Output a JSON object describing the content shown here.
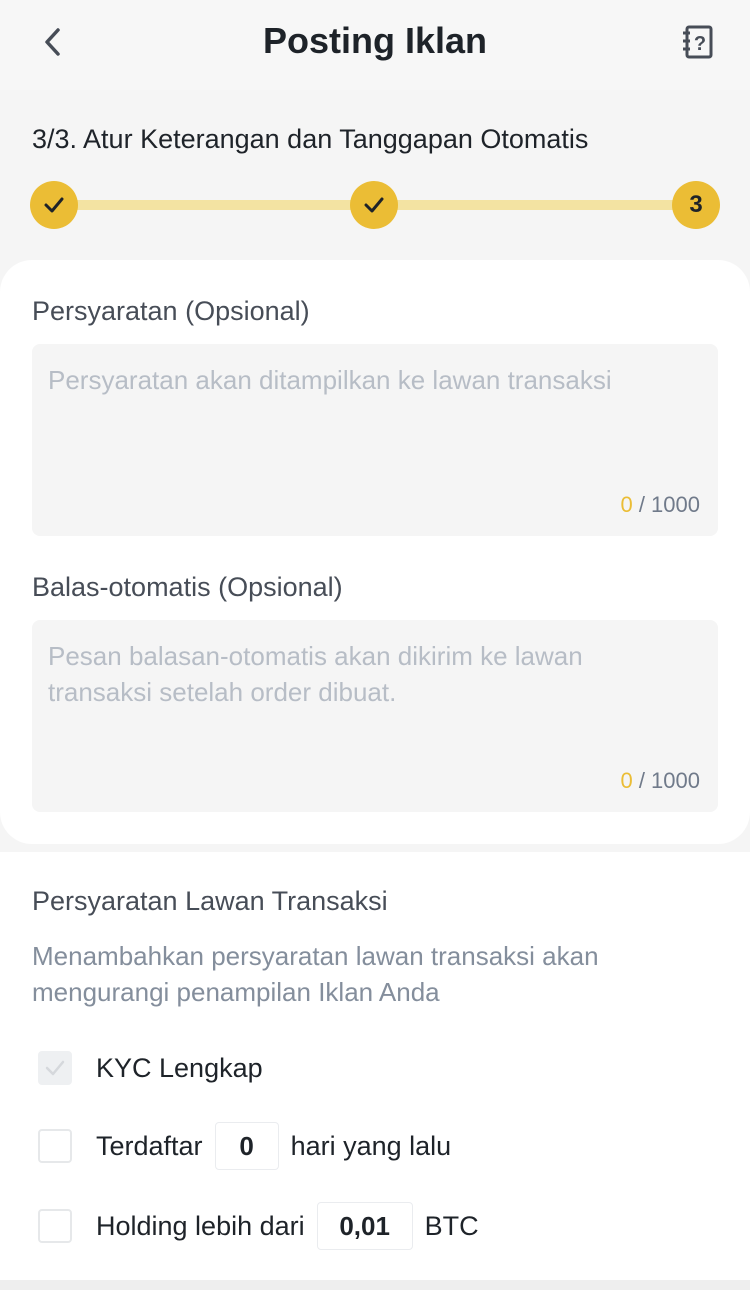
{
  "header": {
    "title": "Posting Iklan",
    "back_icon": "chevron-left-icon",
    "help_icon": "help-guide-icon",
    "help_glyph": "?"
  },
  "step": {
    "title": "3/3. Atur Keterangan dan Tanggapan Otomatis",
    "current_label": "3",
    "total_steps": 3,
    "completed_steps": 2
  },
  "terms": {
    "label": "Persyaratan (Opsional)",
    "placeholder": "Persyaratan akan ditampilkan ke lawan transaksi",
    "count": "0",
    "limit": " / 1000"
  },
  "auto_reply": {
    "label": "Balas-otomatis (Opsional)",
    "placeholder": "Pesan balasan-otomatis akan dikirim ke lawan transaksi setelah order dibuat.",
    "count": "0",
    "limit": " / 1000"
  },
  "counterparty": {
    "title": "Persyaratan Lawan Transaksi",
    "description": "Menambahkan persyaratan lawan transaksi akan mengurangi penampilan Iklan Anda",
    "kyc": {
      "label": "KYC Lengkap",
      "checked": true,
      "disabled": true
    },
    "registered": {
      "prefix": "Terdaftar",
      "value": "0",
      "suffix": "hari yang lalu",
      "checked": false
    },
    "holding": {
      "prefix": "Holding lebih dari",
      "value": "0,01",
      "suffix": "BTC",
      "checked": false
    }
  },
  "colors": {
    "accent": "#EBBD35",
    "accent_light": "#F3E3A2",
    "text_primary": "#1E2329",
    "placeholder": "#B7BDC6"
  }
}
